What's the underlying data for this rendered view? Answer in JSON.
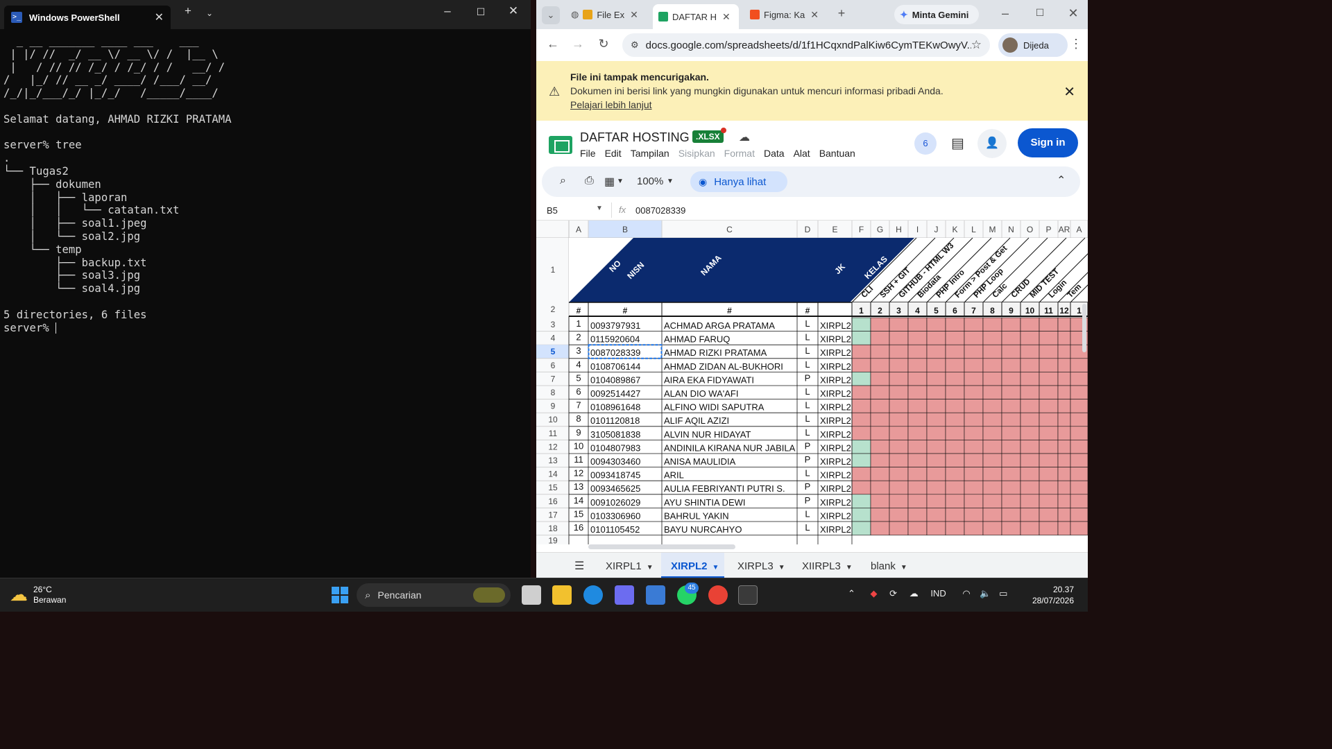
{
  "powershell": {
    "title": "Windows PowerShell",
    "terminal_lines": [
      "  _ __ _______ ____ ___    ___",
      " | |/ //  _/ __ \\/ __ \\/ /  |__ \\",
      " |   / // // /_/ / /_/ / /   __/ /",
      "/   |_/ // __ _/ ____/ /___/ __/",
      "/_/|_/___/_/ |_/_/   /_____/____/",
      "",
      "Selamat datang, AHMAD RIZKI PRATAMA",
      "",
      "server% tree",
      ".",
      "└── Tugas2",
      "    ├── dokumen",
      "    │   ├── laporan",
      "    │   │   └── catatan.txt",
      "    │   ├── soal1.jpeg",
      "    │   └── soal2.jpg",
      "    └── temp",
      "        ├── backup.txt",
      "        ├── soal3.jpg",
      "        └── soal4.jpg",
      "",
      "5 directories, 6 files"
    ],
    "prompt": "server% "
  },
  "browser": {
    "tabs": [
      {
        "label": "File Ex",
        "color": "#e8a317"
      },
      {
        "label": "DAFTAR H",
        "color": "#1ea362"
      },
      {
        "label": "Figma: Ka",
        "color": "#f24e1e"
      }
    ],
    "gemini_label": "Minta Gemini",
    "url": "docs.google.com/spreadsheets/d/1f1HCqxndPalKiw6CymTEKwOwyV...",
    "profile_name": "Dijeda"
  },
  "warning": {
    "title": "File ini tampak mencurigakan.",
    "body": "Dokumen ini berisi link yang mungkin digunakan untuk mencuri informasi pribadi Anda.",
    "link": "Pelajari lebih lanjut"
  },
  "sheet": {
    "title": "DAFTAR HOSTING",
    "badge": ".XLSX",
    "menus": [
      "File",
      "Edit",
      "Tampilan",
      "Sisipkan",
      "Format",
      "Data",
      "Alat",
      "Bantuan"
    ],
    "menus_disabled": [
      "Sisipkan",
      "Format"
    ],
    "collaborators": "6",
    "signin": "Sign in",
    "zoom": "100%",
    "view_only": "Hanya lihat",
    "cell_ref": "B5",
    "formula_value": "0087028339",
    "columns": [
      "A",
      "B",
      "C",
      "D",
      "E",
      "F",
      "G",
      "H",
      "I",
      "J",
      "K",
      "L",
      "M",
      "N",
      "O",
      "P",
      "AR",
      "A"
    ],
    "row_numbers": [
      "1",
      "2",
      "3",
      "4",
      "5",
      "6",
      "7",
      "8",
      "9",
      "10",
      "11",
      "12",
      "13",
      "14",
      "15",
      "16",
      "17",
      "18",
      "19"
    ],
    "header_labels": [
      "NO",
      "NISN",
      "NAMA",
      "JK",
      "KELAS"
    ],
    "task_labels": [
      "CLI",
      "SSH + GIT",
      "GITHUB - HTML W3",
      "Biodata",
      "PHP Intro",
      "Form > Post & Get",
      "PHP Loop",
      "Calc",
      "CRUD",
      "MID TEST",
      "Login",
      "Tem"
    ],
    "row2": [
      "#",
      "#",
      "#",
      "#",
      "",
      "1",
      "2",
      "3",
      "4",
      "5",
      "6",
      "7",
      "8",
      "9",
      "10",
      "11",
      "12",
      "1"
    ],
    "students": [
      {
        "no": "1",
        "nisn": "0093797931",
        "nama": "ACHMAD ARGA PRATAMA",
        "jk": "L",
        "kelas": "XIRPL2",
        "cli_done": true
      },
      {
        "no": "2",
        "nisn": "0115920604",
        "nama": "AHMAD FARUQ",
        "jk": "L",
        "kelas": "XIRPL2",
        "cli_done": true
      },
      {
        "no": "3",
        "nisn": "0087028339",
        "nama": "AHMAD RIZKI PRATAMA",
        "jk": "L",
        "kelas": "XIRPL2",
        "cli_done": false
      },
      {
        "no": "4",
        "nisn": "0108706144",
        "nama": "AHMAD ZIDAN AL-BUKHORI",
        "jk": "L",
        "kelas": "XIRPL2",
        "cli_done": false
      },
      {
        "no": "5",
        "nisn": "0104089867",
        "nama": "AIRA EKA FIDYAWATI",
        "jk": "P",
        "kelas": "XIRPL2",
        "cli_done": true
      },
      {
        "no": "6",
        "nisn": "0092514427",
        "nama": "ALAN DIO WA'AFI",
        "jk": "L",
        "kelas": "XIRPL2",
        "cli_done": false
      },
      {
        "no": "7",
        "nisn": "0108961648",
        "nama": "ALFINO WIDI SAPUTRA",
        "jk": "L",
        "kelas": "XIRPL2",
        "cli_done": false
      },
      {
        "no": "8",
        "nisn": "0101120818",
        "nama": "ALIF AQIL AZIZI",
        "jk": "L",
        "kelas": "XIRPL2",
        "cli_done": false
      },
      {
        "no": "9",
        "nisn": "3105081838",
        "nama": "ALVIN NUR HIDAYAT",
        "jk": "L",
        "kelas": "XIRPL2",
        "cli_done": false
      },
      {
        "no": "10",
        "nisn": "0104807983",
        "nama": "ANDINILA KIRANA NUR JABILA",
        "jk": "P",
        "kelas": "XIRPL2",
        "cli_done": true
      },
      {
        "no": "11",
        "nisn": "0094303460",
        "nama": "ANISA MAULIDIA",
        "jk": "P",
        "kelas": "XIRPL2",
        "cli_done": true
      },
      {
        "no": "12",
        "nisn": "0093418745",
        "nama": "ARIL",
        "jk": "L",
        "kelas": "XIRPL2",
        "cli_done": false
      },
      {
        "no": "13",
        "nisn": "0093465625",
        "nama": "AULIA FEBRIYANTI PUTRI S.",
        "jk": "P",
        "kelas": "XIRPL2",
        "cli_done": false
      },
      {
        "no": "14",
        "nisn": "0091026029",
        "nama": "AYU SHINTIA DEWI",
        "jk": "P",
        "kelas": "XIRPL2",
        "cli_done": true
      },
      {
        "no": "15",
        "nisn": "0103306960",
        "nama": "BAHRUL YAKIN",
        "jk": "L",
        "kelas": "XIRPL2",
        "cli_done": true
      },
      {
        "no": "16",
        "nisn": "0101105452",
        "nama": "BAYU NURCAHYO",
        "jk": "L",
        "kelas": "XIRPL2",
        "cli_done": true
      }
    ],
    "sheet_tabs": [
      "XIRPL1",
      "XIRPL2",
      "XIRPL3",
      "XIIRPL3",
      "blank"
    ],
    "active_tab": "XIRPL2",
    "colors": {
      "header_navy": "#0b2a6e",
      "done_green": "#b7e1cd",
      "pending_red": "#e89a9a",
      "selection": "#1a73e8"
    }
  },
  "taskbar": {
    "temp": "26°C",
    "weather": "Berawan",
    "search_placeholder": "Pencarian",
    "whatsapp_badge": "45",
    "lang": "IND",
    "time": "20.37",
    "date": "28/07/2026"
  }
}
